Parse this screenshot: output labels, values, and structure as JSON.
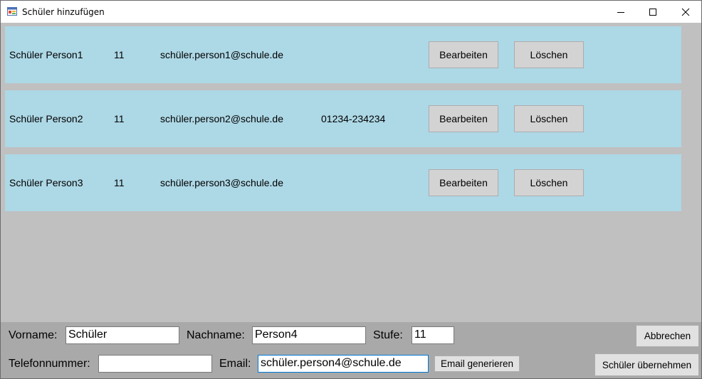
{
  "window": {
    "title": "Schüler hinzufügen"
  },
  "students": [
    {
      "name": "Schüler Person1",
      "grade": "11",
      "email": "schüler.person1@schule.de",
      "phone": "",
      "edit_label": "Bearbeiten",
      "delete_label": "Löschen"
    },
    {
      "name": "Schüler Person2",
      "grade": "11",
      "email": "schüler.person2@schule.de",
      "phone": "01234-234234",
      "edit_label": "Bearbeiten",
      "delete_label": "Löschen"
    },
    {
      "name": "Schüler Person3",
      "grade": "11",
      "email": "schüler.person3@schule.de",
      "phone": "",
      "edit_label": "Bearbeiten",
      "delete_label": "Löschen"
    }
  ],
  "form": {
    "vorname_label": "Vorname:",
    "vorname_value": "Schüler",
    "nachname_label": "Nachname:",
    "nachname_value": "Person4",
    "stufe_label": "Stufe:",
    "stufe_value": "11",
    "telefon_label": "Telefonnummer:",
    "telefon_value": "",
    "email_label": "Email:",
    "email_value": "schüler.person4@schule.de",
    "generate_email_label": "Email generieren",
    "cancel_label": "Abbrechen",
    "submit_label": "Schüler übernehmen"
  },
  "colors": {
    "row_background": "#add8e6",
    "content_background": "#c0c0c0",
    "form_background": "#a9a9a9"
  }
}
